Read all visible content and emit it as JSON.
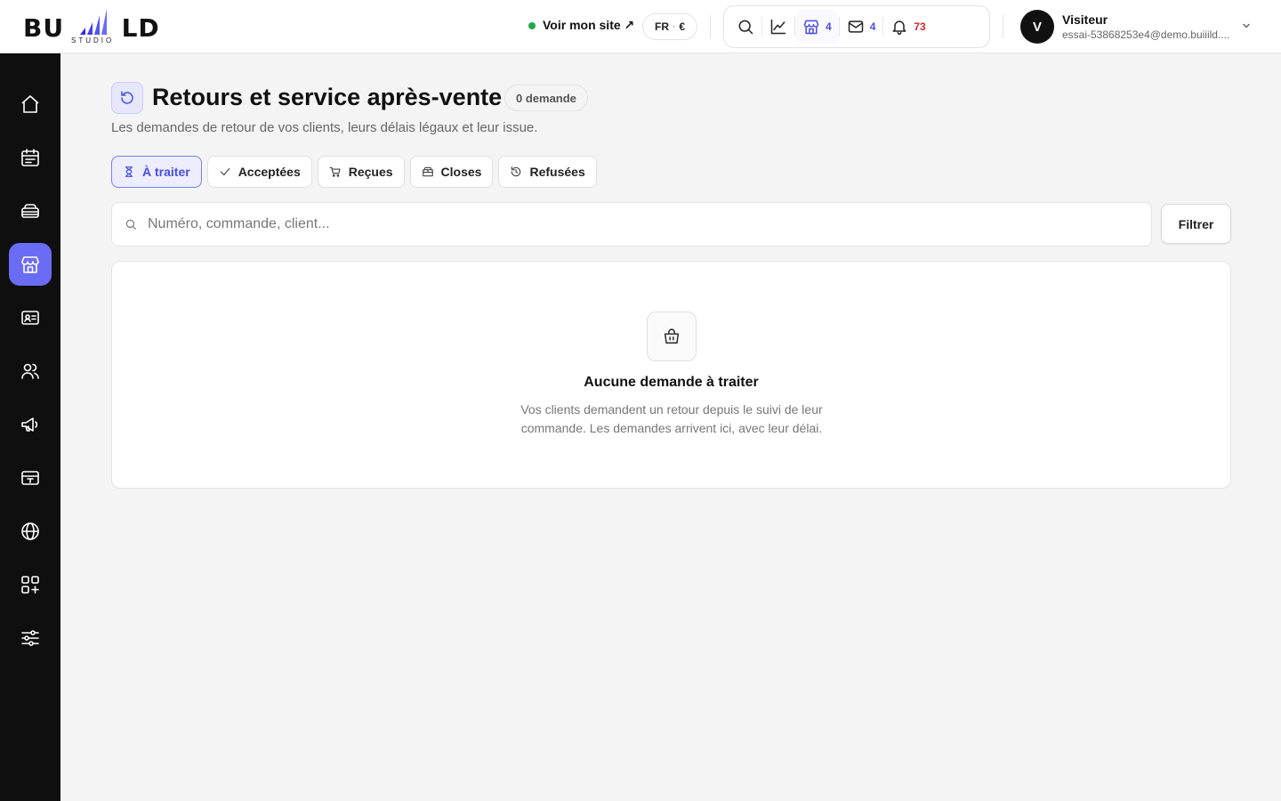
{
  "brand": {
    "logo_text": "BUILD",
    "logo_sub": "STUDIO",
    "accent": "#6b6cf5"
  },
  "topbar": {
    "site_link": "Voir mon site ↗",
    "site_status_color": "#22a846",
    "locale": {
      "lang": "FR",
      "currency": "€"
    },
    "icons": [
      {
        "name": "search-icon"
      },
      {
        "name": "analytics-icon"
      },
      {
        "name": "store-icon",
        "count": "4",
        "count_color": "#4a4ce0"
      },
      {
        "name": "mail-icon",
        "count": "4",
        "count_color": "#4a4ce0"
      },
      {
        "name": "bell-icon",
        "count": "73",
        "count_color": "#d12a2a"
      }
    ],
    "user": {
      "initial": "V",
      "name": "Visiteur",
      "email": "essai-53868253e4@demo.buiiild...."
    }
  },
  "sidebar": {
    "items": [
      {
        "name": "home-icon",
        "active": false
      },
      {
        "name": "calendar-icon",
        "active": false
      },
      {
        "name": "layers-icon",
        "active": false
      },
      {
        "name": "store-icon",
        "active": true
      },
      {
        "name": "contact-card-icon",
        "active": false
      },
      {
        "name": "users-icon",
        "active": false
      },
      {
        "name": "megaphone-icon",
        "active": false
      },
      {
        "name": "payment-card-icon",
        "active": false
      },
      {
        "name": "globe-icon",
        "active": false
      },
      {
        "name": "apps-add-icon",
        "active": false
      },
      {
        "name": "settings-sliders-icon",
        "active": false
      }
    ]
  },
  "page": {
    "title": "Retours et service après-vente",
    "count_badge": "0 demande",
    "subtitle": "Les demandes de retour de vos clients, leurs délais légaux et leur issue.",
    "tabs": [
      {
        "label": "À traiter",
        "icon": "hourglass-icon",
        "active": true
      },
      {
        "label": "Acceptées",
        "icon": "check-icon",
        "active": false
      },
      {
        "label": "Reçues",
        "icon": "cart-icon",
        "active": false
      },
      {
        "label": "Closes",
        "icon": "box-icon",
        "active": false
      },
      {
        "label": "Refusées",
        "icon": "history-icon",
        "active": false
      }
    ],
    "search_placeholder": "Numéro, commande, client...",
    "filter_label": "Filtrer",
    "empty": {
      "icon": "shopping-bag-icon",
      "title": "Aucune demande à traiter",
      "text": "Vos clients demandent un retour depuis le suivi de leur commande. Les demandes arrivent ici, avec leur délai."
    }
  }
}
